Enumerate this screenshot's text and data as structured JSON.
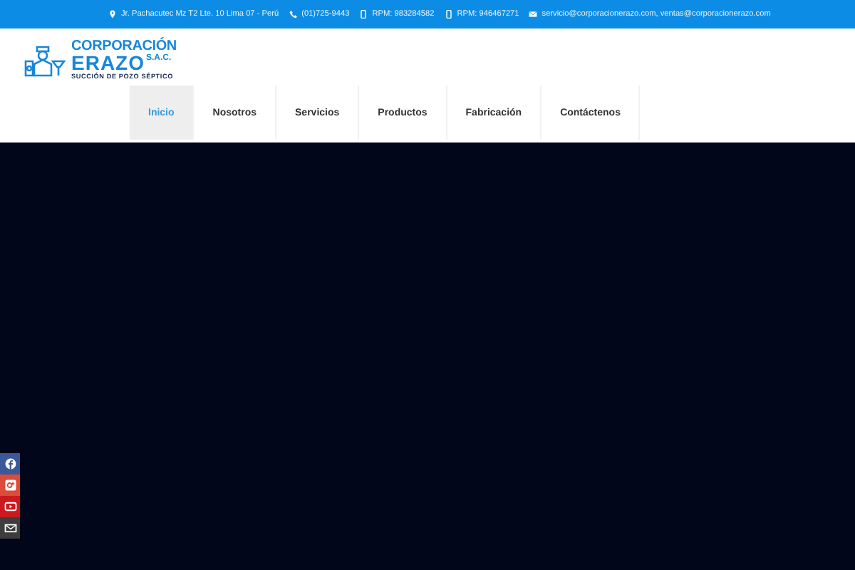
{
  "top_bar": {
    "items": [
      {
        "kind": "location",
        "text": "Jr. Pachacutec Mz T2 Lte. 10 Lima 07 - Perú"
      },
      {
        "kind": "phone",
        "text": "(01)725-9443"
      },
      {
        "kind": "mobile",
        "text": "RPM: 983284582"
      },
      {
        "kind": "mobile",
        "text": "RPM: 946467271"
      },
      {
        "kind": "mail",
        "text": "servicio@corporacionerazo.com, ventas@corporacionerazo.com"
      }
    ]
  },
  "logo": {
    "line1": "CORPORACIÓN",
    "line2": "ERAZO",
    "suffix": "S.A.C.",
    "tagline": "SUCCIÓN DE POZO SÉPTICO"
  },
  "nav": [
    {
      "label": "Inicio",
      "selected": true
    },
    {
      "label": "Nosotros",
      "selected": false
    },
    {
      "label": "Servicios",
      "selected": false
    },
    {
      "label": "Productos",
      "selected": false
    },
    {
      "label": "Fabricación",
      "selected": false
    },
    {
      "label": "Contáctenos",
      "selected": false
    }
  ],
  "social": [
    {
      "kind": "facebook"
    },
    {
      "kind": "google-plus"
    },
    {
      "kind": "youtube"
    },
    {
      "kind": "mail"
    }
  ]
}
